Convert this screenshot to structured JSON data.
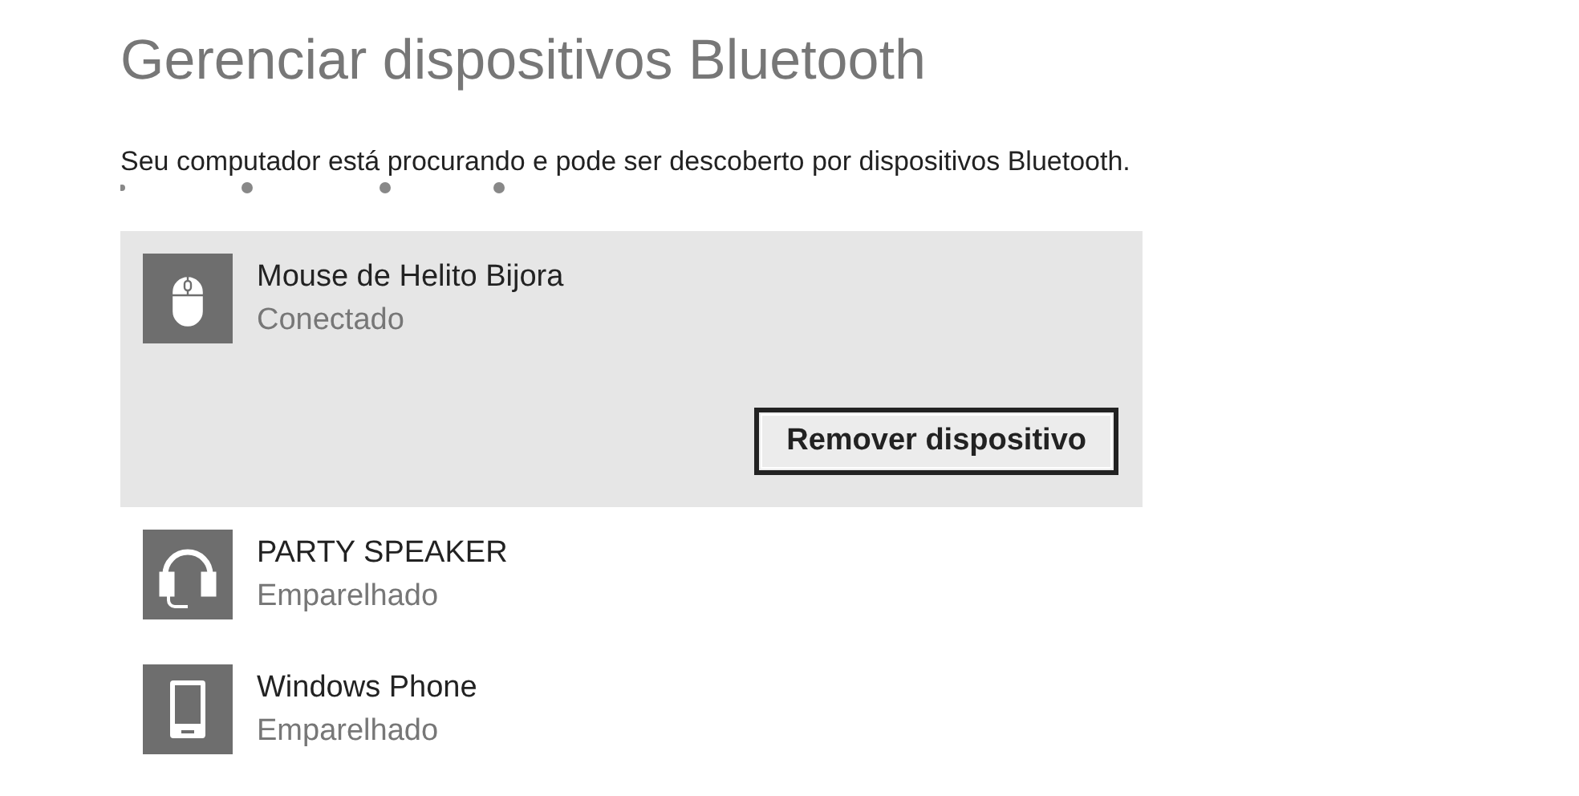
{
  "title": "Gerenciar dispositivos Bluetooth",
  "description": "Seu computador está procurando e pode ser descoberto por dispositivos Bluetooth.",
  "devices": [
    {
      "kind": "mouse",
      "name": "Mouse de Helito Bijora",
      "status": "Conectado",
      "selected": true,
      "action": "Remover dispositivo"
    },
    {
      "kind": "headset",
      "name": "PARTY SPEAKER",
      "status": "Emparelhado",
      "selected": false
    },
    {
      "kind": "phone",
      "name": "Windows Phone",
      "status": "Emparelhado",
      "selected": false
    }
  ]
}
